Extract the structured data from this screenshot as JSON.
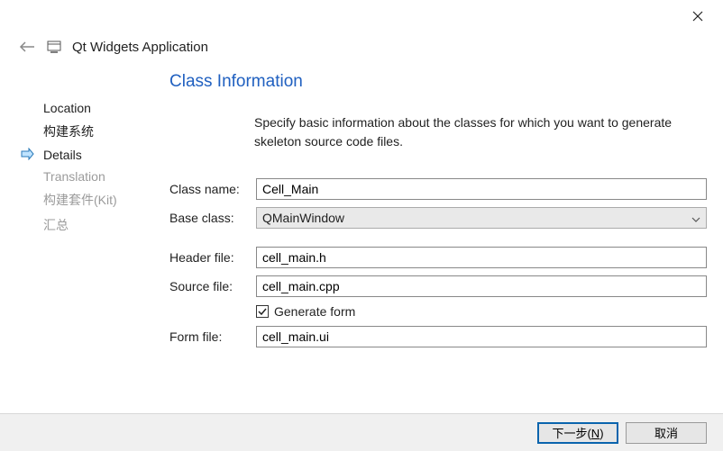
{
  "window": {
    "title": "Qt Widgets Application"
  },
  "sidebar": {
    "items": [
      {
        "label": "Location",
        "state": "done"
      },
      {
        "label": "构建系统",
        "state": "done"
      },
      {
        "label": "Details",
        "state": "active"
      },
      {
        "label": "Translation",
        "state": "disabled"
      },
      {
        "label": "构建套件(Kit)",
        "state": "disabled"
      },
      {
        "label": "汇总",
        "state": "disabled"
      }
    ]
  },
  "page": {
    "title": "Class Information",
    "description": "Specify basic information about the classes for which you want to generate skeleton source code files."
  },
  "form": {
    "class_name": {
      "label": "Class name:",
      "value": "Cell_Main"
    },
    "base_class": {
      "label": "Base class:",
      "value": "QMainWindow"
    },
    "header_file": {
      "label": "Header file:",
      "value": "cell_main.h"
    },
    "source_file": {
      "label": "Source file:",
      "value": "cell_main.cpp"
    },
    "generate_form": {
      "label": "Generate form",
      "checked": true
    },
    "form_file": {
      "label": "Form file:",
      "value": "cell_main.ui"
    }
  },
  "footer": {
    "next_label": "下一步(N)",
    "cancel_label": "取消"
  }
}
